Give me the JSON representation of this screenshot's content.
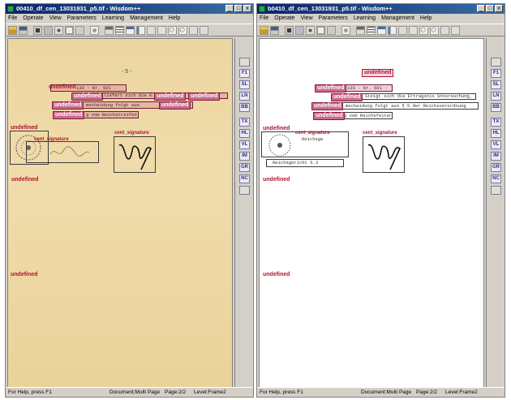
{
  "windows": {
    "left": {
      "title": "00410_df_cen_13031931_p5.tif - Wisdom++",
      "page_number": "- 5 -",
      "text_lines": [
        "130 - Nr. 501 -",
        "liefert sich die Ent",
        "mecheidung folgt aus",
        "g vom Reichstreifen"
      ]
    },
    "right": {
      "title": "b0410_df_cen_13031931_p5.tif - Wisdom++",
      "text_lines": [
        "135 - Nr. 501 -",
        "Steigt sich die Ertragsnis Untersuchung,",
        "mecheidung folgt aus § 5 der Reichsverordnung",
        "g vom Reichsfeiten"
      ],
      "stamp_text": "Reichsge",
      "stamp_under": "Reichsgericht 5.3"
    }
  },
  "window_controls": {
    "minimize": "_",
    "maximize": "□",
    "close": "x"
  },
  "menu": [
    "File",
    "Operate",
    "View",
    "Parameters",
    "Learning",
    "Management",
    "Help"
  ],
  "side_buttons": [
    "F1",
    "SL",
    "LN",
    "BB",
    "TX",
    "HL",
    "VL",
    "IM",
    "GR",
    "NC"
  ],
  "labels": {
    "undefined": "undefined",
    "cent_signature": "cent_signature"
  },
  "status": {
    "help": "For Help, press F1",
    "document": "Document:Multi Page",
    "page": "Page:2/2",
    "level": "Level:Frame2"
  },
  "colors": {
    "title_bar": "#0a246a",
    "scan_background": "#ecd6a0",
    "label_red": "#b01230",
    "label_pink": "#c86a8c"
  }
}
